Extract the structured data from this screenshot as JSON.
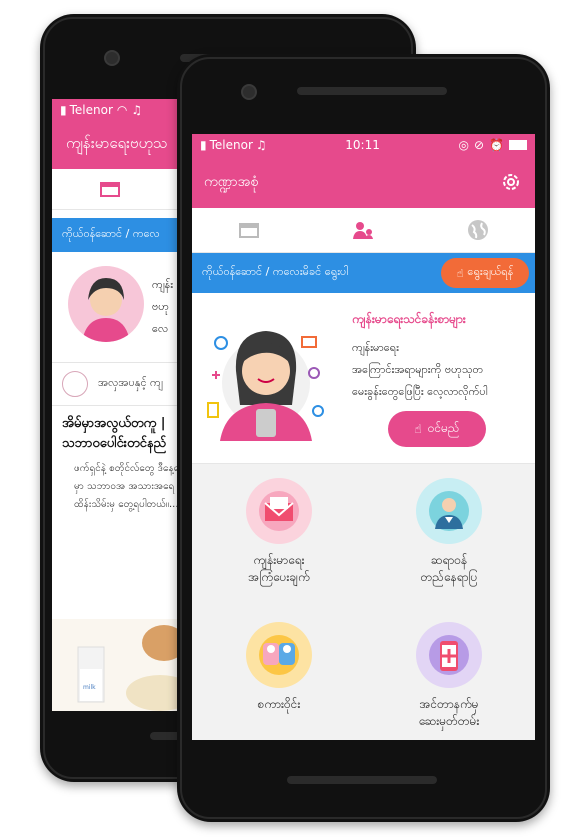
{
  "back_phone": {
    "status": {
      "carrier": "Telenor"
    },
    "app_title": "ကျန်းမာရေးဗဟုသ",
    "blue_bar_text": "ကိုယ်ဝန်ဆောင် / ကလေ",
    "card": {
      "title": "ကျန်း",
      "line1": "ဗဟု",
      "line2": "လေ"
    },
    "section_header": "အလှအပနှင့် ကျ",
    "article": {
      "title": "အိမ်မှာအလွယ်တကူ | သဘာဝပေါင်းတင်နည်",
      "body": "ဖက်ရှင်နဲ့ စတိုင်လ်တွေ ဒီနေ့ခေတ်မှာ သဘာဝအ အသားအရေထိန်းသိမ်းမှ တွေ့ရပါတယ်။..."
    },
    "image_label": "milk"
  },
  "front_phone": {
    "status": {
      "carrier": "Telenor",
      "time": "10:11"
    },
    "app_title": "ကဏ္ဍာအစုံ",
    "tabs": [
      {
        "icon": "calendar-icon"
      },
      {
        "icon": "mother-child-icon",
        "active": true
      },
      {
        "icon": "globe-icon"
      }
    ],
    "blue_bar": {
      "text": "ကိုယ်ဝန်ဆောင် / ကလေးမိခင် ရွေးပါ",
      "button": "ရွေးချယ်ရန်"
    },
    "card": {
      "title": "ကျန်းမာရေးသင်ခန်းစာများ",
      "body": "ကျန်းမာရေး\nအကြောင်းအရာများကို ဗဟုသုတ\nမေးခွန်းတွေဖြေပြီး လေ့လာလိုက်ပါ",
      "button": "ဝင်မည်"
    },
    "features": [
      {
        "label": "ကျန်းမာရေး\nအကြံပေးချက်",
        "icon": "envelope-icon"
      },
      {
        "label": "ဆရာဝန်\nတည်နေရာပြ",
        "icon": "doctor-icon"
      },
      {
        "label": "စကားဝိုင်း",
        "icon": "chat-people-icon"
      },
      {
        "label": "အင်တာနက်မှ\nဆေးမှတ်တမ်း",
        "icon": "phone-medical-icon"
      }
    ]
  },
  "colors": {
    "primary": "#e64a8c",
    "blue": "#2d8fe3",
    "orange": "#f26b38"
  }
}
